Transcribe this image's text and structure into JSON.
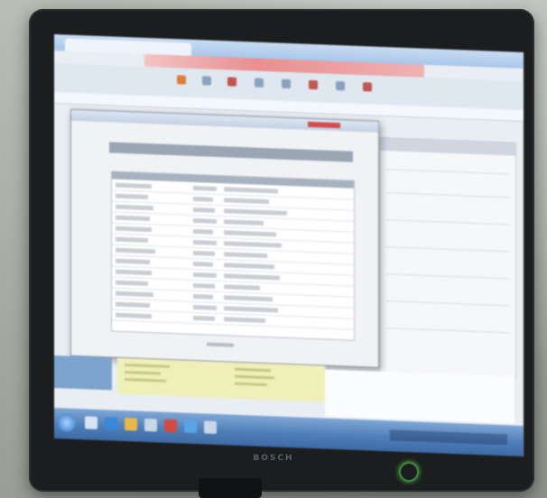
{
  "monitor": {
    "brand": "BOSCH"
  },
  "colors": {
    "bezel": "#1c1d1e",
    "screen": "#e9eef3",
    "taskbar": "#4f7eb8",
    "power_led": "#52c24f",
    "alert_red": "#c23a32",
    "yellow_panel": "#eef0b7"
  },
  "icons": [
    "power-icon",
    "windows-start-icon"
  ]
}
